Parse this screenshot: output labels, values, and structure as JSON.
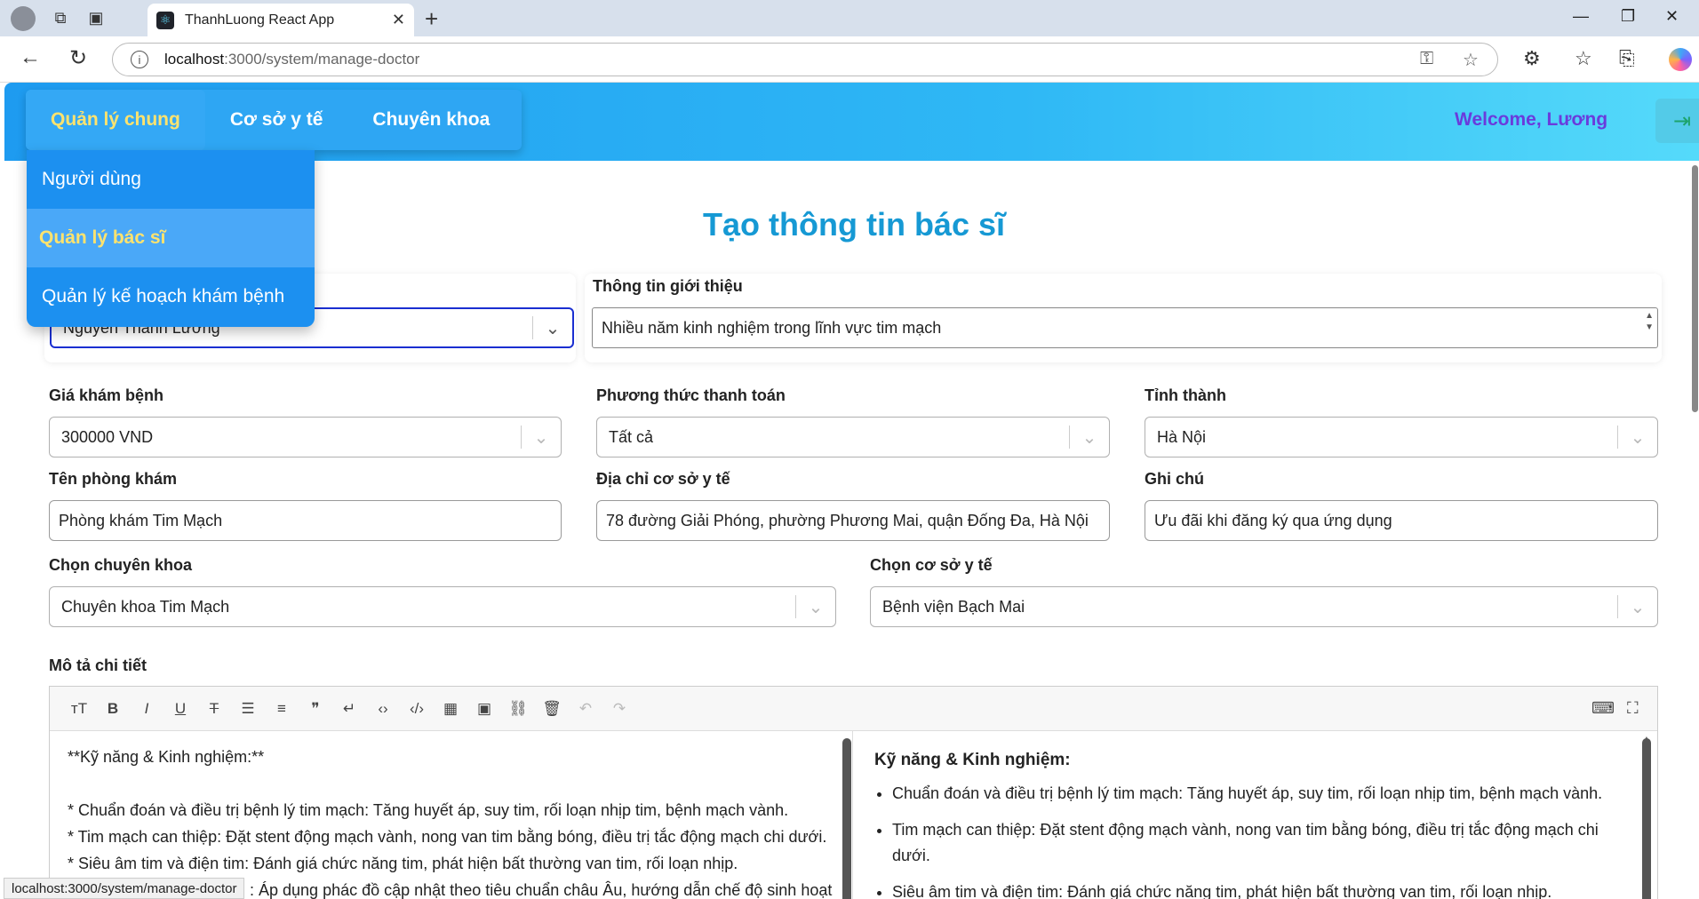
{
  "browser": {
    "tab_title": "ThanhLuong React App",
    "url_host": "localhost",
    "url_path": ":3000/system/manage-doctor",
    "status_url": "localhost:3000/system/manage-doctor"
  },
  "header": {
    "nav": [
      "Quản lý chung",
      "Cơ sở y tế",
      "Chuyên khoa"
    ],
    "welcome": "Welcome, Lương"
  },
  "dropdown": [
    "Người dùng",
    "Quản lý bác sĩ",
    "Quản lý kế hoạch khám bệnh"
  ],
  "page": {
    "title": "Tạo thông tin bác sĩ",
    "doctor_select_value": "Nguyễn Thành Lương",
    "intro_label": "Thông tin giới thiệu",
    "intro_value": "Nhiều năm kinh nghiệm trong lĩnh vực tim mạch"
  },
  "form": {
    "price_label": "Giá khám bệnh",
    "price_value": "300000 VND",
    "payment_label": "Phương thức thanh toán",
    "payment_value": "Tất cả",
    "province_label": "Tỉnh thành",
    "province_value": "Hà Nội",
    "clinic_name_label": "Tên phòng khám",
    "clinic_name_value": "Phòng khám Tim Mạch",
    "clinic_address_label": "Địa chỉ cơ sở y tế",
    "clinic_address_value": "78 đường Giải Phóng, phường Phương Mai, quận Đống Đa, Hà Nội",
    "note_label": "Ghi chú",
    "note_value": "Ưu đãi khi đăng ký qua ứng dụng",
    "specialty_label": "Chọn chuyên khoa",
    "specialty_value": "Chuyên khoa Tim Mạch",
    "facility_label": "Chọn cơ sở y tế",
    "facility_value": "Bệnh viện Bạch Mai",
    "detail_label": "Mô tả chi tiết"
  },
  "editor": {
    "markdown_lines": [
      "**Kỹ năng & Kinh nghiệm:**",
      "",
      "* Chuẩn đoán và điều trị bệnh lý tim mạch: Tăng huyết áp, suy tim, rối loạn nhịp tim, bệnh mạch vành.",
      "* Tim mạch can thiệp: Đặt stent động mạch vành, nong van tim bằng bóng, điều trị tắc động mạch chi dưới.",
      "* Siêu âm tim và điện tim: Đánh giá chức năng tim, phát hiện bất thường van tim, rối loạn nhịp.",
      ": Áp dụng phác đồ cập nhật theo tiêu chuẩn châu Âu, hướng dẫn chế độ sinh hoạt"
    ],
    "preview_heading": "Kỹ năng & Kinh nghiệm:",
    "preview_items": [
      "Chuẩn đoán và điều trị bệnh lý tim mạch: Tăng huyết áp, suy tim, rối loạn nhịp tim, bệnh mạch vành.",
      "Tim mạch can thiệp: Đặt stent động mạch vành, nong van tim bằng bóng, điều trị tắc động mạch chi dưới.",
      "Siêu âm tim và điện tim: Đánh giá chức năng tim, phát hiện bất thường van tim, rối loạn nhịp."
    ],
    "tools": [
      "heading-icon",
      "bold-icon",
      "italic-icon",
      "underline-icon",
      "strikethrough-icon",
      "unordered-list-icon",
      "ordered-list-icon",
      "quote-icon",
      "wrap-icon",
      "code-icon",
      "code-block-icon",
      "table-icon",
      "image-icon",
      "link-icon",
      "clear-icon",
      "undo-icon",
      "redo-icon"
    ]
  },
  "colors": {
    "header_start": "#1e9bf0",
    "header_end": "#55dafa",
    "active_nav": "#ffe36e",
    "title": "#1699d4",
    "welcome": "#6a3bdc"
  }
}
